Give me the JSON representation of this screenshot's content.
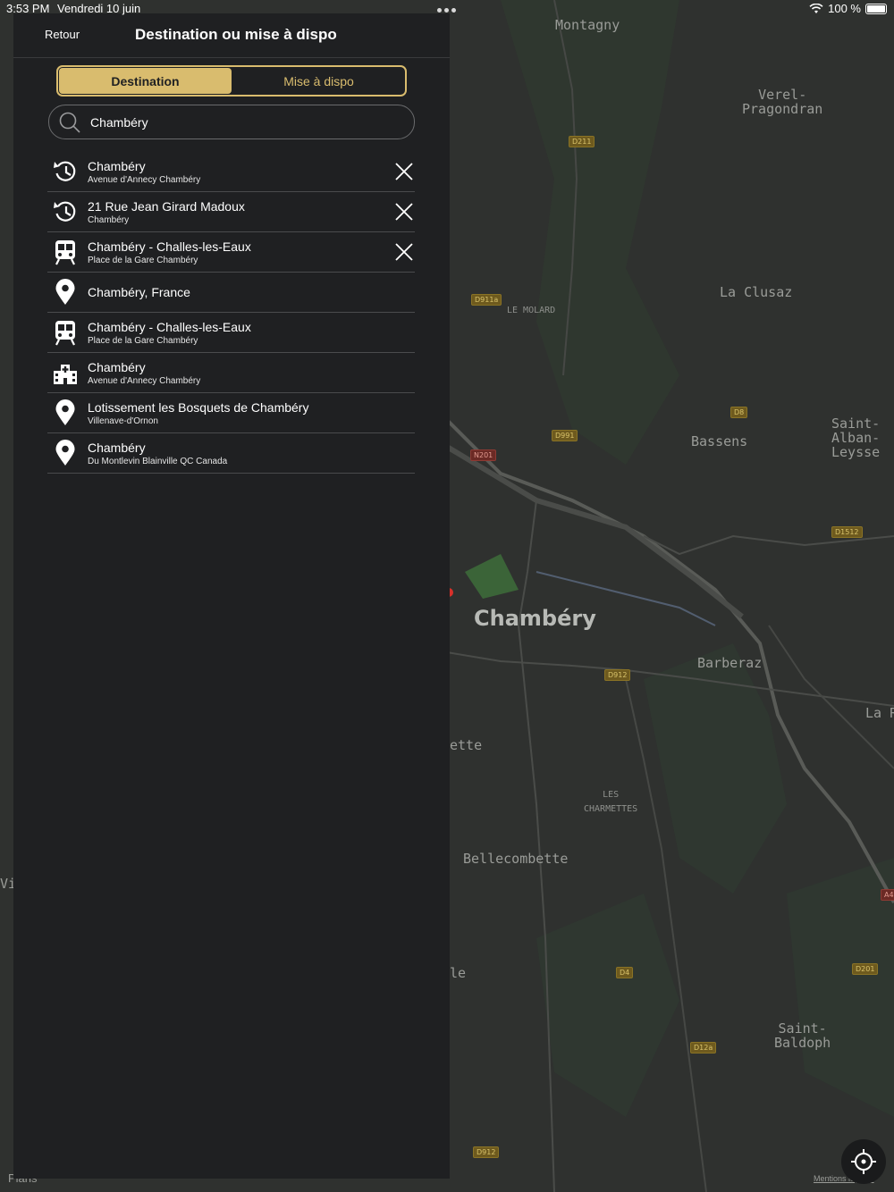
{
  "status_bar": {
    "time": "3:53 PM",
    "date": "Vendredi 10 juin",
    "battery": "100 %"
  },
  "header": {
    "back_label": "Retour",
    "title": "Destination ou mise à dispo"
  },
  "tabs": [
    {
      "label": "Destination",
      "active": true
    },
    {
      "label": "Mise à dispo",
      "active": false
    }
  ],
  "search": {
    "value": "Chambéry",
    "placeholder": ""
  },
  "results": [
    {
      "icon": "history-icon",
      "title": "Chambéry",
      "subtitle": "Avenue d'Annecy Chambéry",
      "removable": true
    },
    {
      "icon": "history-icon",
      "title": "21 Rue Jean Girard Madoux",
      "subtitle": "Chambéry",
      "removable": true
    },
    {
      "icon": "train-icon",
      "title": "Chambéry - Challes-les-Eaux",
      "subtitle": "Place de la Gare Chambéry",
      "removable": true
    },
    {
      "icon": "location-pin-icon",
      "title": "Chambéry, France",
      "subtitle": "",
      "removable": false
    },
    {
      "icon": "train-icon",
      "title": "Chambéry - Challes-les-Eaux",
      "subtitle": "Place de la Gare Chambéry",
      "removable": false
    },
    {
      "icon": "hospital-icon",
      "title": "Chambéry",
      "subtitle": "Avenue d'Annecy Chambéry",
      "removable": false
    },
    {
      "icon": "location-pin-icon",
      "title": "Lotissement les Bosquets de Chambéry",
      "subtitle": "Villenave-d'Ornon",
      "removable": false
    },
    {
      "icon": "location-pin-icon",
      "title": "Chambéry",
      "subtitle": "Du Montlevin Blainville QC Canada",
      "removable": false
    }
  ],
  "map": {
    "places": [
      "Montagny",
      "Verel-\nPragondran",
      "La Clusaz",
      "LE MOLARD",
      "Bassens",
      "Saint-\nAlban-\nLeysse",
      "Chambéry",
      "Barberaz",
      "La R",
      "ette",
      "LES\nCHARMETTES",
      "Bellecombette",
      "le",
      "Saint-\nBaldoph",
      "Vi"
    ],
    "roads": [
      "D211",
      "D911a",
      "D8",
      "D991",
      "N201",
      "D1512",
      "D912",
      "D4",
      "D201",
      "D12a",
      "D912",
      "A4"
    ],
    "app_label": "Plans",
    "legal_label": "Mentions légales"
  },
  "colors": {
    "accent": "#d9bc6e",
    "panel": "#1f2022",
    "map": "#2e302f"
  }
}
